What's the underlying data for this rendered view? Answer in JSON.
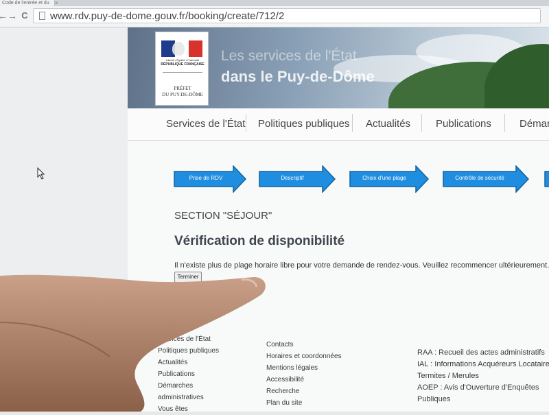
{
  "browser": {
    "tab_title": "Code de l'entrée et du",
    "tab_close": "×",
    "back_icon": "←",
    "forward_icon": "→",
    "reload_icon": "C",
    "url": "www.rdv.puy-de-dome.gouv.fr/booking/create/712/2"
  },
  "header": {
    "logo_motto": "Liberté • Égalité • Fraternité",
    "logo_republic": "RÉPUBLIQUE FRANÇAISE",
    "logo_prefet_line1": "PRÉFET",
    "logo_prefet_line2": "DU PUY-DE-DÔME",
    "title_line1": "Les services de l'État",
    "title_line2": "dans le Puy-de-Dôme",
    "flag_colors": [
      "#1f3b8c",
      "#ffffff",
      "#d9322b"
    ]
  },
  "nav": {
    "items": [
      "Services de l'État",
      "Politiques publiques",
      "Actualités",
      "Publications",
      "Démarches"
    ]
  },
  "steps": {
    "items": [
      "Prise de RDV",
      "Descriptif",
      "Choix d'une plage",
      "Contrôle de sécurité"
    ],
    "color": "#1f8de0"
  },
  "main": {
    "section_heading": "SECTION \"SÉJOUR\"",
    "title": "Vérification de disponibilité",
    "message": "Il n'existe plus de plage horaire libre pour votre demande de rendez-vous. Veuillez recommencer ultérieurement.",
    "finish_button": "Terminer"
  },
  "footer": {
    "col1": [
      "Services de l'État",
      "Politiques publiques",
      "Actualités",
      "Publications",
      "Démarches",
      "administratives",
      "Vous êtes"
    ],
    "col2": [
      "Contacts",
      "Horaires et coordonnées",
      "Mentions légales",
      "Accessibilité",
      "Recherche",
      "Plan du site"
    ],
    "col3": [
      "RAA : Recueil des actes administratifs",
      "IAL : Informations Acquéreurs Locataires",
      "Termites / Merules",
      "AOEP : Avis d'Ouverture d'Enquêtes",
      "Publiques"
    ]
  }
}
